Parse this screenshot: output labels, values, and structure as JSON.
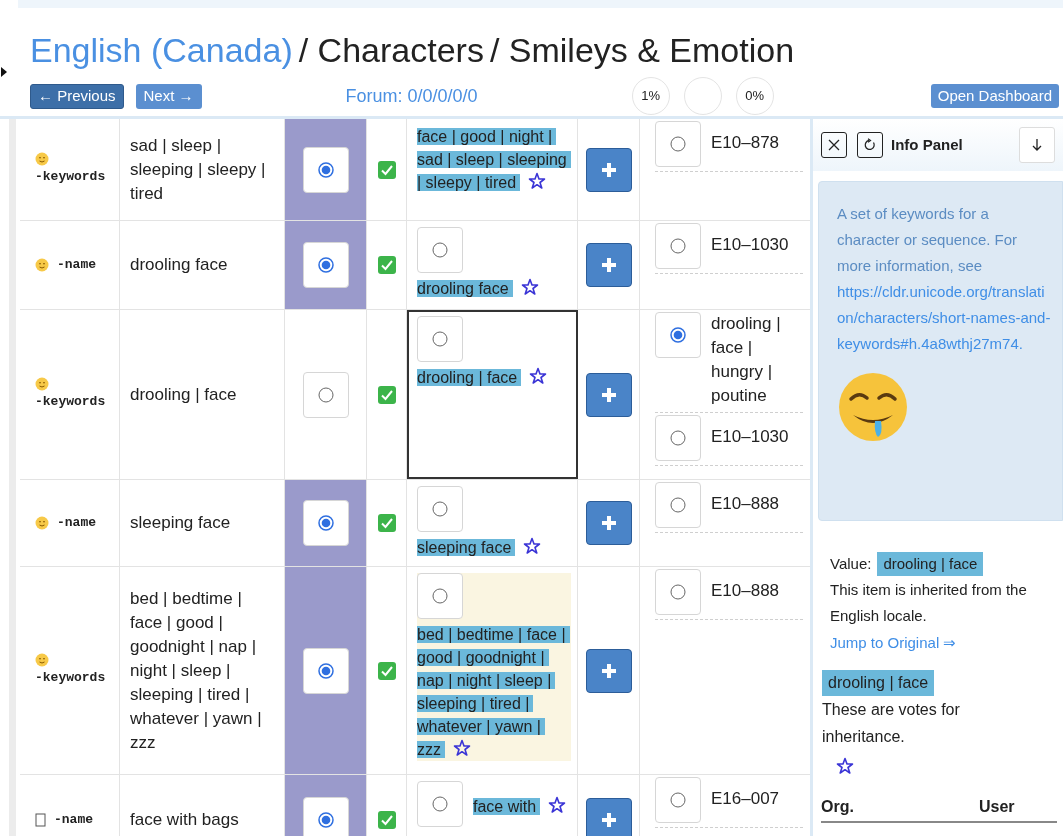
{
  "header": {
    "locale": "English (Canada)",
    "crumbs": [
      "/ Characters",
      "/ Smileys & Emotion"
    ]
  },
  "nav": {
    "previous": "← Previous",
    "next": "Next →",
    "forum": "Forum: 0/0/0/0/0",
    "progress": [
      "1%",
      "0%"
    ],
    "dashboard": "Open Dashboard"
  },
  "rows": [
    {
      "kind": "emoji",
      "code": "-keywords",
      "english": "sad | sleep | sleeping | sleepy | tired",
      "vote_selected": true,
      "approved": true,
      "winner": {
        "text": "face | good | night | sad | sleep | sleeping | sleepy | tired",
        "radio": false,
        "focused": false,
        "highlighted": false
      },
      "others": [
        {
          "text": "E10–878",
          "selected": false
        }
      ]
    },
    {
      "kind": "emoji",
      "code": "-name",
      "english": "drooling face",
      "vote_selected": true,
      "approved": true,
      "winner": {
        "text": "drooling face",
        "radio": true,
        "focused": false,
        "highlighted": false
      },
      "others": [
        {
          "text": "E10–1030",
          "selected": false
        }
      ]
    },
    {
      "kind": "emoji",
      "code": "-keywords",
      "english": "drooling | face",
      "vote_selected": false,
      "approved": true,
      "winner": {
        "text": "drooling | face",
        "radio": true,
        "focused": true,
        "highlighted": false
      },
      "others": [
        {
          "text": "drooling | face | hungry | poutine",
          "selected": true
        },
        {
          "text": "E10–1030",
          "selected": false
        }
      ]
    },
    {
      "kind": "emoji",
      "code": "-name",
      "english": "sleeping face",
      "vote_selected": true,
      "approved": true,
      "winner": {
        "text": "sleeping face",
        "radio": true,
        "focused": false,
        "highlighted": false
      },
      "others": [
        {
          "text": "E10–888",
          "selected": false
        }
      ]
    },
    {
      "kind": "emoji",
      "code": "-keywords",
      "english": "bed | bedtime | face | good | goodnight | nap | night | sleep | sleeping | tired | whatever | yawn | zzz",
      "vote_selected": true,
      "approved": true,
      "winner": {
        "text": "bed | bedtime | face | good | goodnight | nap | night | sleep | sleeping | tired | whatever | yawn | zzz",
        "radio": true,
        "focused": false,
        "highlighted": true
      },
      "others": [
        {
          "text": "E10–888",
          "selected": false
        }
      ]
    },
    {
      "kind": "missing",
      "code": "-name",
      "english": "face with bags",
      "vote_selected": true,
      "approved": true,
      "winner": {
        "text": "face with",
        "radio": true,
        "focused": false,
        "highlighted": false
      },
      "others": [
        {
          "text": "E16–007",
          "selected": false
        }
      ]
    }
  ],
  "info_panel": {
    "title": "Info Panel",
    "description": "A set of keywords for a character or sequence. For more information, see",
    "link": "https://cldr.unicode.org/translation/characters/short-names-and-keywords#h.4a8wthj27m74.",
    "value_label": "Value:",
    "value": "drooling | face",
    "inherited_note": "This item is inherited from the English locale.",
    "jump": "Jump to Original ⇒",
    "vote_value": "drooling | face",
    "votes_note": "These are votes for inheritance.",
    "columns": [
      "Org.",
      "User"
    ]
  }
}
